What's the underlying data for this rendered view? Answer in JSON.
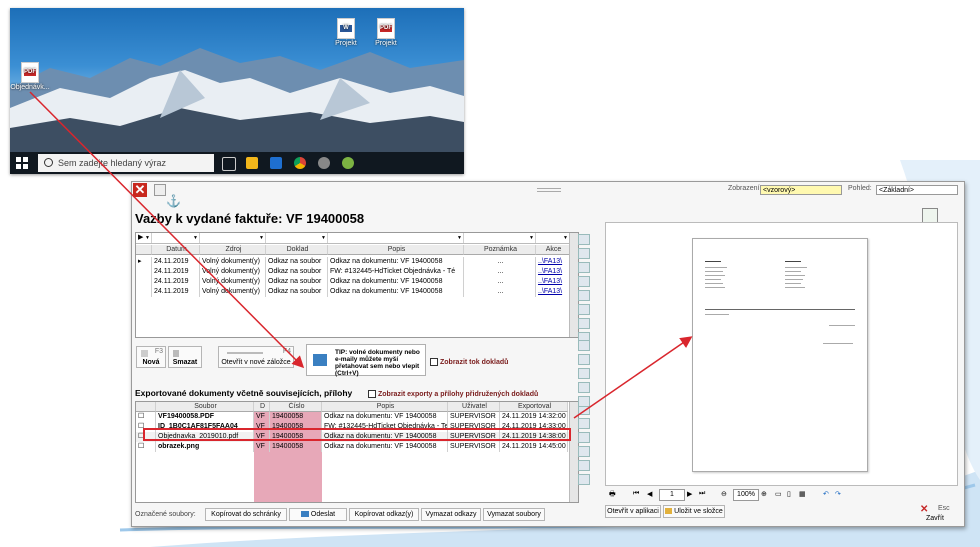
{
  "desktop": {
    "icon_left_label": "Objednávk...",
    "icon_word_label": "Projekt",
    "icon_pdf_label": "Projekt",
    "search_placeholder": "Sem zadejte hledaný výraz"
  },
  "app": {
    "title": "Vazby k vydané faktuře: VF 19400058",
    "close_glyph": "✕",
    "anchor_glyph": "⚓",
    "zobrazeni_label": "Zobrazení:",
    "zobrazeni_value": "<vzorový>",
    "pohled_label": "Pohled:",
    "pohled_value": "<Základní>"
  },
  "links_grid": {
    "headers": [
      "Datum",
      "Zdroj",
      "Doklad",
      "Popis",
      "Poznámka",
      "Akce"
    ],
    "rows": [
      {
        "datum": "24.11.2019",
        "zdroj": "Volný dokument(y)",
        "doklad": "Odkaz na soubor",
        "popis": "Odkaz na dokumentu: VF 19400058",
        "poznamka": "...",
        "akce": "..\\FA13\\"
      },
      {
        "datum": "24.11.2019",
        "zdroj": "Volný dokument(y)",
        "doklad": "Odkaz na soubor",
        "popis": "FW: #132445-HdTicket Objednávka - Té",
        "poznamka": "...",
        "akce": "..\\FA13\\"
      },
      {
        "datum": "24.11.2019",
        "zdroj": "Volný dokument(y)",
        "doklad": "Odkaz na soubor",
        "popis": "Odkaz na dokumentu: VF 19400058",
        "poznamka": "...",
        "akce": "..\\FA13\\"
      },
      {
        "datum": "24.11.2019",
        "zdroj": "Volný dokument(y)",
        "doklad": "Odkaz na soubor",
        "popis": "Odkaz na dokumentu: VF 19400058",
        "poznamka": "...",
        "akce": "..\\FA13\\"
      }
    ]
  },
  "actions": {
    "nova_key": "F3",
    "nova_label": "Nová",
    "smazat_label": "Smazat",
    "otevrit_key": "F4",
    "otevrit_label": "Otevřít v nové záložce",
    "tip_text": "TIP: volné dokumenty nebo e-maily můžete myší přetahovat sem nebo vlepit (Ctrl+V)",
    "tok_label": "Zobrazit tok dokladů"
  },
  "exports": {
    "section_title": "Exportované dokumenty včetně souvisejících, přílohy",
    "show_label": "Zobrazit exporty a přílohy přidružených dokladů",
    "headers": [
      "Soubor",
      "D",
      "Číslo",
      "Popis",
      "Uživatel",
      "Exportoval"
    ],
    "rows": [
      {
        "soubor": "VF19400058.PDF",
        "d": "VF",
        "cislo": "19400058",
        "popis": "Odkaz na dokumentu: VF 19400058",
        "uzivatel": "SUPERVISOR",
        "exportoval": "24.11.2019 14:32:00"
      },
      {
        "soubor": "ID_1B0C1AF81F5FAA04",
        "d": "VF",
        "cislo": "19400058",
        "popis": "FW: #132445-HdTicket Objednávka - Tes",
        "uzivatel": "SUPERVISOR",
        "exportoval": "24.11.2019 14:33:00"
      },
      {
        "soubor": "Objednavka_2019010.pdf",
        "d": "VF",
        "cislo": "19400058",
        "popis": "Odkaz na dokumentu: VF 19400058",
        "uzivatel": "SUPERVISOR",
        "exportoval": "24.11.2019 14:38:00"
      },
      {
        "soubor": "obrazek.png",
        "d": "VF",
        "cislo": "19400058",
        "popis": "Odkaz na dokumentu: VF 19400058",
        "uzivatel": "SUPERVISOR",
        "exportoval": "24.11.2019 14:45:00"
      }
    ]
  },
  "bottom": {
    "label": "Označené soubory:",
    "btn_copy_clipboard": "Kopírovat do schránky",
    "btn_send": "Odeslat",
    "btn_copy_links": "Kopírovat odkaz(y)",
    "btn_clear_links": "Vymazat odkazy",
    "btn_clear_files": "Vymazat soubory"
  },
  "preview": {
    "page_number": "1",
    "zoom": "100%",
    "open_in_app": "Otevřít v aplikaci",
    "save_to_folder": "Uložit ve složce",
    "esc_key": "Esc",
    "close_label": "Zavřít"
  }
}
